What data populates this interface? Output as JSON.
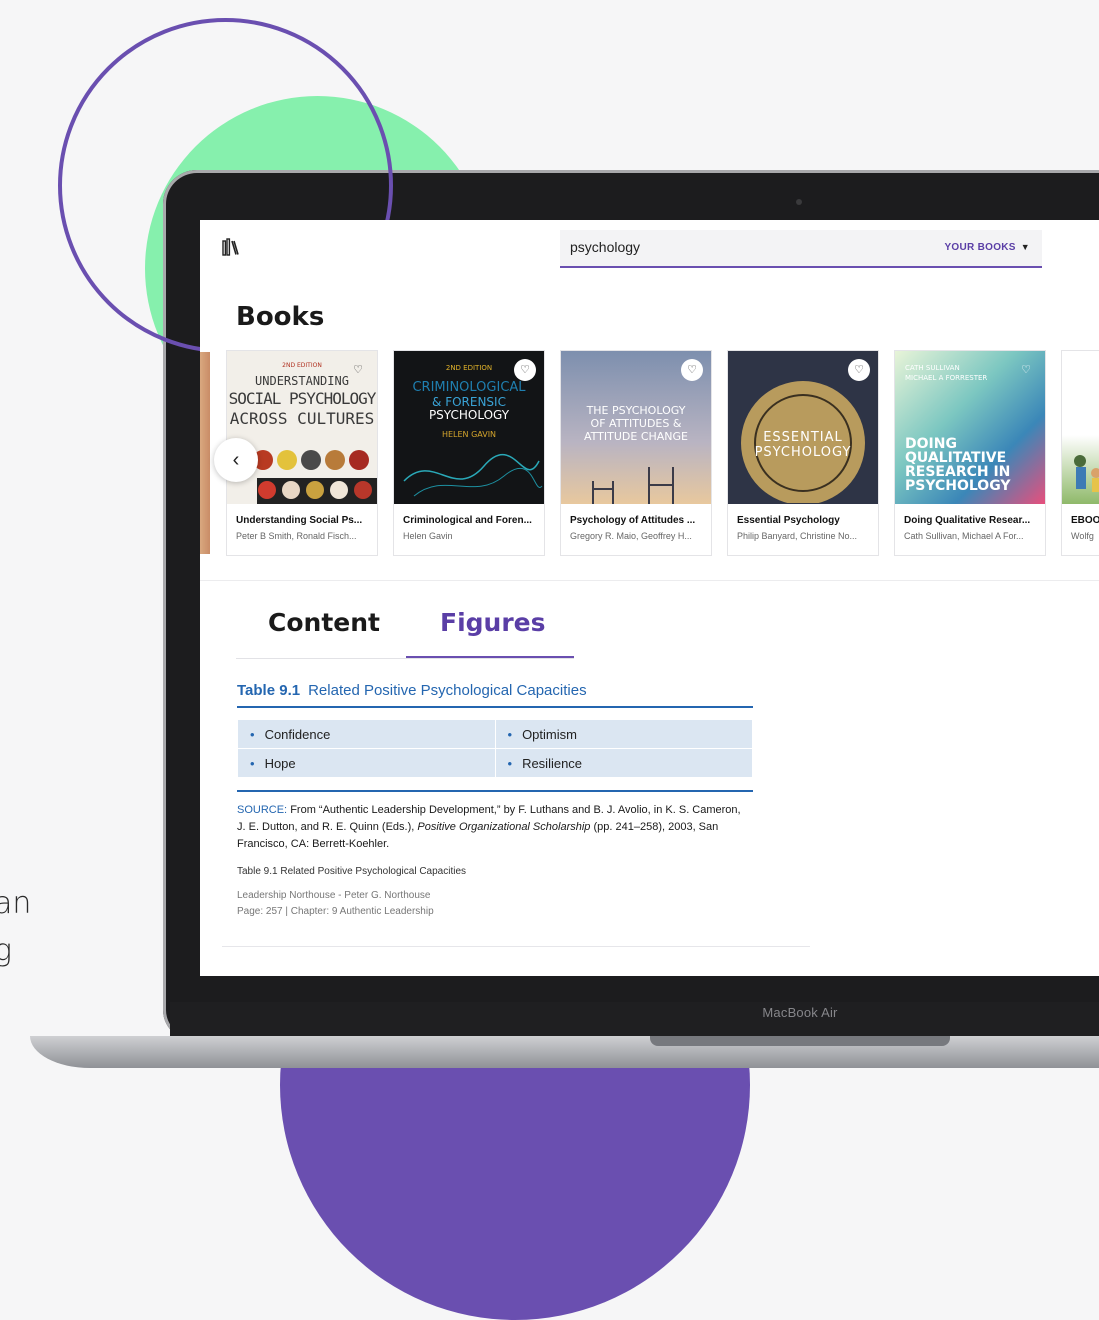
{
  "side_text": {
    "line1": "an",
    "line2": "g"
  },
  "device": {
    "label": "MacBook Air"
  },
  "app": {
    "search": {
      "value": "psychology"
    },
    "your_books": {
      "label": "YOUR BOOKS"
    },
    "books_section_title": "Books",
    "books": [
      {
        "title": "Understanding Social Ps...",
        "author": "Peter B Smith, Ronald Fisch...",
        "cover": {
          "line1": "2ND EDITION",
          "line2": "UNDERSTANDING",
          "line3": "SOCIAL PSYCHOLOGY",
          "line4": "ACROSS CULTURES"
        }
      },
      {
        "title": "Criminological and Foren...",
        "author": "Helen Gavin",
        "cover": {
          "line1": "2ND EDITION",
          "line2": "CRIMINOLOGICAL",
          "line3": "& FORENSIC",
          "line4": "PSYCHOLOGY",
          "line5": "HELEN GAVIN"
        }
      },
      {
        "title": "Psychology of Attitudes ...",
        "author": "Gregory R. Maio, Geoffrey H...",
        "cover": {
          "line1": "THE PSYCHOLOGY",
          "line2": "OF ATTITUDES &",
          "line3": "ATTITUDE CHANGE"
        }
      },
      {
        "title": "Essential Psychology",
        "author": "Philip Banyard, Christine No...",
        "cover": {
          "line1": "ESSENTIAL",
          "line2": "PSYCHOLOGY"
        }
      },
      {
        "title": "Doing Qualitative Resear...",
        "author": "Cath Sullivan, Michael A For...",
        "cover": {
          "line1": "CATH SULLIVAN",
          "line2": "MICHAEL A FORRESTER",
          "line3": "DOING",
          "line4": "QUALITATIVE",
          "line5": "RESEARCH IN",
          "line6": "PSYCHOLOGY"
        }
      },
      {
        "title": "EBOO",
        "author": "Wolfg"
      }
    ],
    "tabs": [
      {
        "label": "Content",
        "active": false
      },
      {
        "label": "Figures",
        "active": true
      }
    ],
    "figure": {
      "number": "Table 9.1",
      "title": "Related Positive Psychological Capacities",
      "rows": [
        [
          "Confidence",
          "Optimism"
        ],
        [
          "Hope",
          "Resilience"
        ]
      ],
      "source_label": "SOURCE:",
      "source_text_1": "From “Authentic Leadership Development,” by F. Luthans and B. J. Avolio, in K. S. Cameron, J. E. Dutton, and R. E. Quinn (Eds.),",
      "source_italic": "Positive Organizational Scholarship",
      "source_text_2": "(pp. 241–258), 2003, San Francisco, CA: Berrett-Koehler.",
      "caption": "Table 9.1 Related Positive Psychological Capacities",
      "book_line": "Leadership Northouse - Peter G. Northouse",
      "page_line": "Page: 257 | Chapter: 9 Authentic Leadership"
    }
  },
  "colors": {
    "accent": "#6a4fb0",
    "green": "#86f0ad",
    "figure_blue": "#2466b0",
    "table_fill": "#dbe6f2"
  },
  "icons": [
    "library-logo-icon",
    "chevron-down-icon",
    "heart-icon",
    "chevron-left-icon"
  ]
}
